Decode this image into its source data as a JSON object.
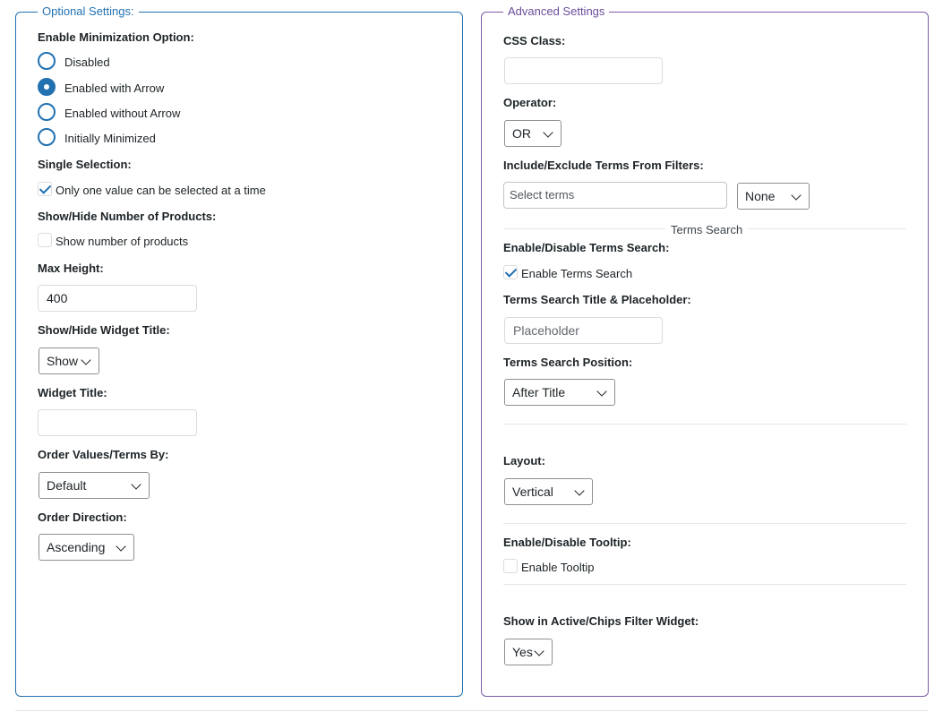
{
  "optional": {
    "legend": "Optional Settings:",
    "minimization": {
      "label": "Enable Minimization Option:",
      "options": [
        "Disabled",
        "Enabled with Arrow",
        "Enabled without Arrow",
        "Initially Minimized"
      ],
      "selected": "Enabled with Arrow"
    },
    "single_selection": {
      "label": "Single Selection:",
      "checkbox_label": "Only one value can be selected at a time",
      "checked": true
    },
    "show_products": {
      "label": "Show/Hide Number of Products:",
      "checkbox_label": "Show number of products",
      "checked": false
    },
    "max_height": {
      "label": "Max Height:",
      "value": "400"
    },
    "widget_title_toggle": {
      "label": "Show/Hide Widget Title:",
      "value": "Show"
    },
    "widget_title": {
      "label": "Widget Title:",
      "value": ""
    },
    "order_by": {
      "label": "Order Values/Terms By:",
      "value": "Default"
    },
    "order_direction": {
      "label": "Order Direction:",
      "value": "Ascending"
    }
  },
  "advanced": {
    "legend": "Advanced Settings",
    "css_class": {
      "label": "CSS Class:",
      "value": ""
    },
    "operator": {
      "label": "Operator:",
      "value": "OR"
    },
    "include_exclude": {
      "label": "Include/Exclude Terms From Filters:",
      "placeholder": "Select terms",
      "mode": "None"
    },
    "terms_search_section": "Terms Search",
    "terms_search": {
      "label": "Enable/Disable Terms Search:",
      "checkbox_label": "Enable Terms Search",
      "checked": true
    },
    "terms_search_title": {
      "label": "Terms Search Title & Placeholder:",
      "placeholder": "Placeholder"
    },
    "terms_search_position": {
      "label": "Terms Search Position:",
      "value": "After Title"
    },
    "layout": {
      "label": "Layout:",
      "value": "Vertical"
    },
    "tooltip": {
      "label": "Enable/Disable Tooltip:",
      "checkbox_label": "Enable Tooltip",
      "checked": false
    },
    "chips": {
      "label": "Show in Active/Chips Filter Widget:",
      "value": "Yes"
    }
  },
  "colors": {
    "optional_border": "#2271b1",
    "advanced_border": "#7b5ca8",
    "accent": "#2271b1"
  }
}
